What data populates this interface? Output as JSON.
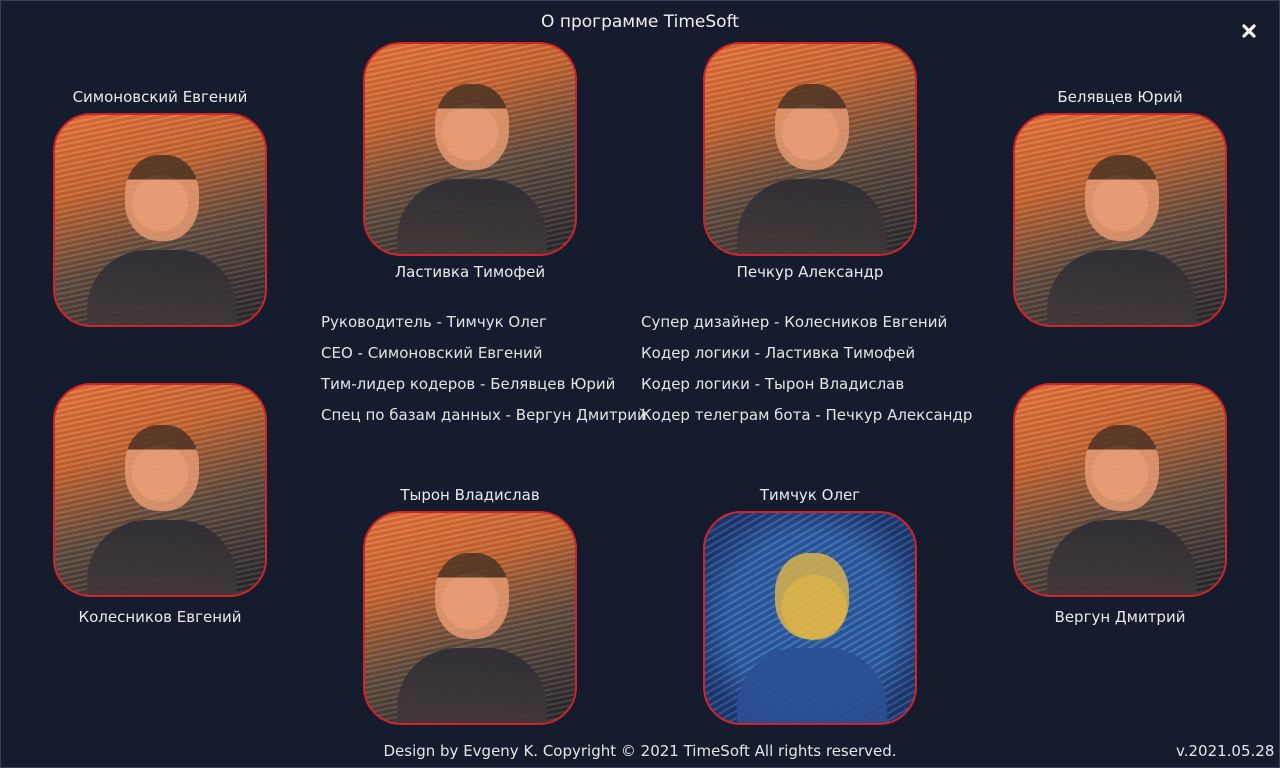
{
  "window": {
    "title": "О программе TimeSoft"
  },
  "members": {
    "simonovsky": "Симоновский Евгений",
    "lastivka": "Ластивка Тимофей",
    "pechkur": "Печкур Александр",
    "belyavtsev": "Белявцев Юрий",
    "kolesnikov": "Колесников Евгений",
    "tyron": "Тырон Владислав",
    "timchuk": "Тимчук Олег",
    "vergun": "Вергун Дмитрий"
  },
  "credits": {
    "left": [
      "Руководитель - Тимчук Олег",
      "CEO - Симоновский Евгений",
      "Тим-лидер кодеров - Белявцев Юрий",
      "Спец по базам данных - Вергун Дмитрий"
    ],
    "right": [
      "Супер дизайнер - Колесников Евгений",
      "Кодер логики - Ластивка Тимофей",
      "Кодер логики - Тырон Владислав",
      "Кодер телеграм бота - Печкур Александр"
    ]
  },
  "footer": {
    "copyright": "Design by Evgeny K. Copyright © 2021 TimeSoft All rights reserved.",
    "version": "v.2021.05.28"
  },
  "icons": {
    "close": "close-icon"
  },
  "colors": {
    "background": "#151c2e",
    "photo_border": "#d2232a",
    "text": "#e8e8e8"
  }
}
